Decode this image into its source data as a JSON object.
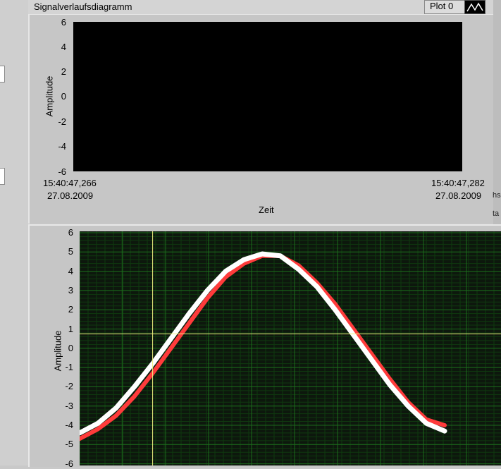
{
  "window": {
    "title": "Signalverlaufsdiagramm",
    "plot_legend_label": "Plot 0"
  },
  "upper_chart": {
    "y_label": "Amplitude",
    "x_label": "Zeit",
    "y_ticks": [
      "6",
      "4",
      "2",
      "0",
      "-2",
      "-4",
      "-6"
    ],
    "x_start_time": "15:40:47,266",
    "x_start_date": "27.08.2009",
    "x_end_time": "15:40:47,282",
    "x_end_date": "27.08.2009"
  },
  "side_fragments": [
    "hs",
    "ta"
  ],
  "chart_data": {
    "type": "line",
    "ylabel": "Amplitude",
    "ylim": [
      -6,
      6
    ],
    "yticks": [
      "6",
      "5",
      "4",
      "3",
      "2",
      "1",
      "0",
      "-1",
      "-2",
      "-3",
      "-4",
      "-5",
      "-6"
    ],
    "grid": true,
    "x": [
      0,
      0.1,
      0.2,
      0.3,
      0.4,
      0.5,
      0.6,
      0.7,
      0.8,
      0.9,
      1.0,
      1.1,
      1.2,
      1.3,
      1.4,
      1.5,
      1.6,
      1.7,
      1.8,
      1.9,
      2.0
    ],
    "series": [
      {
        "color": "#ff3b3b",
        "values": [
          -4.7,
          -4.2,
          -3.5,
          -2.5,
          -1.3,
          0.0,
          1.3,
          2.6,
          3.7,
          4.4,
          4.8,
          4.8,
          4.3,
          3.4,
          2.3,
          1.0,
          -0.3,
          -1.6,
          -2.8,
          -3.7,
          -4.0
        ]
      },
      {
        "color": "#ffffff",
        "values": [
          -4.4,
          -3.9,
          -3.1,
          -2.0,
          -0.8,
          0.5,
          1.8,
          3.0,
          4.0,
          4.6,
          4.9,
          4.8,
          4.1,
          3.2,
          2.0,
          0.7,
          -0.6,
          -1.9,
          -3.0,
          -3.9,
          -4.3
        ]
      }
    ],
    "cursor": {
      "color": "#f0f080",
      "x": 0.4,
      "y": 0.75
    },
    "colors": {
      "background": "#0d170d",
      "grid": "#1c6a1c",
      "minor_grid": "#0f3a0f"
    }
  }
}
